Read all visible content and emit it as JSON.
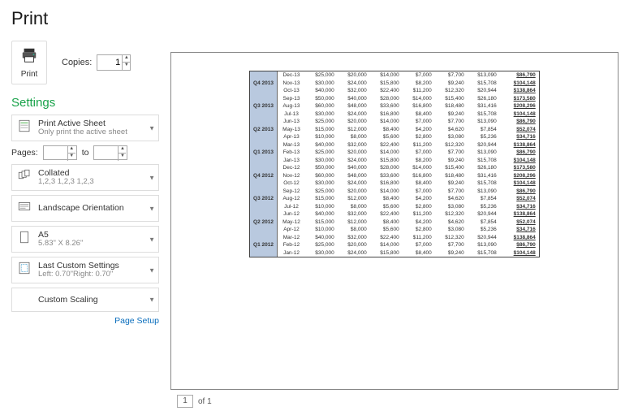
{
  "title": "Print",
  "print_label": "Print",
  "copies_label": "Copies:",
  "copies_value": "1",
  "settings_heading": "Settings",
  "opt_print_active": {
    "title": "Print Active Sheet",
    "sub": "Only print the active sheet"
  },
  "pages_label": "Pages:",
  "to_label": "to",
  "opt_collated": {
    "title": "Collated",
    "sub": "1,2,3  1,2,3  1,2,3"
  },
  "opt_orientation": {
    "title": "Landscape Orientation"
  },
  "opt_paper": {
    "title": "A5",
    "sub": "5.83\" X 8.26\""
  },
  "opt_margins": {
    "title": "Last Custom Settings",
    "sub": "Left: 0.70\"Right: 0.70\""
  },
  "opt_scaling": {
    "title": "Custom Scaling"
  },
  "page_setup_link": "Page Setup",
  "page_current": "1",
  "page_of": "of 1",
  "chart_data": {
    "type": "table",
    "columns": [
      "quarter",
      "month",
      "c1",
      "c2",
      "c3",
      "c4",
      "c5",
      "c6",
      "total"
    ],
    "rows": [
      {
        "quarter": "Q4 2013",
        "month": "Dec-13",
        "c1": "$25,000",
        "c2": "$20,000",
        "c3": "$14,000",
        "c4": "$7,000",
        "c5": "$7,700",
        "c6": "$13,090",
        "total": "$86,790"
      },
      {
        "quarter": "",
        "month": "Nov-13",
        "c1": "$30,000",
        "c2": "$24,000",
        "c3": "$15,800",
        "c4": "$8,200",
        "c5": "$9,240",
        "c6": "$15,708",
        "total": "$104,148"
      },
      {
        "quarter": "",
        "month": "Oct-13",
        "c1": "$40,000",
        "c2": "$32,000",
        "c3": "$22,400",
        "c4": "$11,200",
        "c5": "$12,320",
        "c6": "$20,944",
        "total": "$138,864"
      },
      {
        "quarter": "Q3 2013",
        "month": "Sep-13",
        "c1": "$50,000",
        "c2": "$40,000",
        "c3": "$28,000",
        "c4": "$14,000",
        "c5": "$15,400",
        "c6": "$26,180",
        "total": "$173,580"
      },
      {
        "quarter": "",
        "month": "Aug-13",
        "c1": "$60,000",
        "c2": "$48,000",
        "c3": "$33,600",
        "c4": "$16,800",
        "c5": "$18,480",
        "c6": "$31,416",
        "total": "$208,296"
      },
      {
        "quarter": "",
        "month": "Jul-13",
        "c1": "$30,000",
        "c2": "$24,000",
        "c3": "$16,800",
        "c4": "$8,400",
        "c5": "$9,240",
        "c6": "$15,708",
        "total": "$104,148"
      },
      {
        "quarter": "Q2 2013",
        "month": "Jun-13",
        "c1": "$25,000",
        "c2": "$20,000",
        "c3": "$14,000",
        "c4": "$7,000",
        "c5": "$7,700",
        "c6": "$13,090",
        "total": "$86,790"
      },
      {
        "quarter": "",
        "month": "May-13",
        "c1": "$15,000",
        "c2": "$12,000",
        "c3": "$8,400",
        "c4": "$4,200",
        "c5": "$4,620",
        "c6": "$7,854",
        "total": "$52,074"
      },
      {
        "quarter": "",
        "month": "Apr-13",
        "c1": "$10,000",
        "c2": "$8,000",
        "c3": "$5,600",
        "c4": "$2,800",
        "c5": "$3,080",
        "c6": "$5,236",
        "total": "$34,716"
      },
      {
        "quarter": "Q1 2013",
        "month": "Mar-13",
        "c1": "$40,000",
        "c2": "$32,000",
        "c3": "$22,400",
        "c4": "$11,200",
        "c5": "$12,320",
        "c6": "$20,944",
        "total": "$138,864"
      },
      {
        "quarter": "",
        "month": "Feb-13",
        "c1": "$25,000",
        "c2": "$20,000",
        "c3": "$14,000",
        "c4": "$7,000",
        "c5": "$7,700",
        "c6": "$13,090",
        "total": "$86,790"
      },
      {
        "quarter": "",
        "month": "Jan-13",
        "c1": "$30,000",
        "c2": "$24,000",
        "c3": "$15,800",
        "c4": "$8,200",
        "c5": "$9,240",
        "c6": "$15,708",
        "total": "$104,148"
      },
      {
        "quarter": "Q4 2012",
        "month": "Dec-12",
        "c1": "$50,000",
        "c2": "$40,000",
        "c3": "$28,000",
        "c4": "$14,000",
        "c5": "$15,400",
        "c6": "$26,180",
        "total": "$173,580"
      },
      {
        "quarter": "",
        "month": "Nov-12",
        "c1": "$60,000",
        "c2": "$48,000",
        "c3": "$33,600",
        "c4": "$16,800",
        "c5": "$18,480",
        "c6": "$31,416",
        "total": "$208,296"
      },
      {
        "quarter": "",
        "month": "Oct-12",
        "c1": "$30,000",
        "c2": "$24,000",
        "c3": "$16,800",
        "c4": "$8,400",
        "c5": "$9,240",
        "c6": "$15,708",
        "total": "$104,148"
      },
      {
        "quarter": "Q3 2012",
        "month": "Sep-12",
        "c1": "$25,000",
        "c2": "$20,000",
        "c3": "$14,000",
        "c4": "$7,000",
        "c5": "$7,700",
        "c6": "$13,090",
        "total": "$86,790"
      },
      {
        "quarter": "",
        "month": "Aug-12",
        "c1": "$15,000",
        "c2": "$12,000",
        "c3": "$8,400",
        "c4": "$4,200",
        "c5": "$4,620",
        "c6": "$7,854",
        "total": "$52,074"
      },
      {
        "quarter": "",
        "month": "Jul-12",
        "c1": "$10,000",
        "c2": "$8,000",
        "c3": "$5,600",
        "c4": "$2,800",
        "c5": "$3,080",
        "c6": "$5,236",
        "total": "$34,716"
      },
      {
        "quarter": "Q2 2012",
        "month": "Jun-12",
        "c1": "$40,000",
        "c2": "$32,000",
        "c3": "$22,400",
        "c4": "$11,200",
        "c5": "$12,320",
        "c6": "$20,944",
        "total": "$138,864"
      },
      {
        "quarter": "",
        "month": "May-12",
        "c1": "$15,000",
        "c2": "$12,000",
        "c3": "$8,400",
        "c4": "$4,200",
        "c5": "$4,620",
        "c6": "$7,854",
        "total": "$52,074"
      },
      {
        "quarter": "",
        "month": "Apr-12",
        "c1": "$10,000",
        "c2": "$8,000",
        "c3": "$5,600",
        "c4": "$2,800",
        "c5": "$3,080",
        "c6": "$5,236",
        "total": "$34,716"
      },
      {
        "quarter": "Q1 2012",
        "month": "Mar-12",
        "c1": "$40,000",
        "c2": "$32,000",
        "c3": "$22,400",
        "c4": "$11,200",
        "c5": "$12,320",
        "c6": "$20,944",
        "total": "$138,864"
      },
      {
        "quarter": "",
        "month": "Feb-12",
        "c1": "$25,000",
        "c2": "$20,000",
        "c3": "$14,000",
        "c4": "$7,000",
        "c5": "$7,700",
        "c6": "$13,090",
        "total": "$86,790"
      },
      {
        "quarter": "",
        "month": "Jan-12",
        "c1": "$30,000",
        "c2": "$24,000",
        "c3": "$15,800",
        "c4": "$8,400",
        "c5": "$9,240",
        "c6": "$15,708",
        "total": "$104,148"
      }
    ]
  }
}
